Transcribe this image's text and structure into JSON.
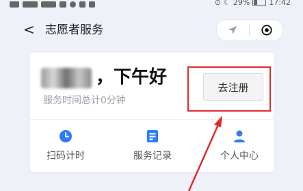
{
  "status_bar": {
    "battery": "29%",
    "time": "17:42"
  },
  "nav": {
    "back_symbol": "<",
    "title": "志愿者服务",
    "location_icon": "location-arrow-icon",
    "target_icon": "target-icon"
  },
  "card": {
    "greeting": "，下午好",
    "service_time": "服务时间总计0分钟",
    "register_label": "去注册"
  },
  "functions": [
    {
      "label": "扫码计时",
      "icon": "clock-icon"
    },
    {
      "label": "服务记录",
      "icon": "records-icon"
    },
    {
      "label": "个人中心",
      "icon": "person-icon"
    }
  ],
  "colors": {
    "accent": "#2e7cf6",
    "annotation": "#e02a2a"
  }
}
